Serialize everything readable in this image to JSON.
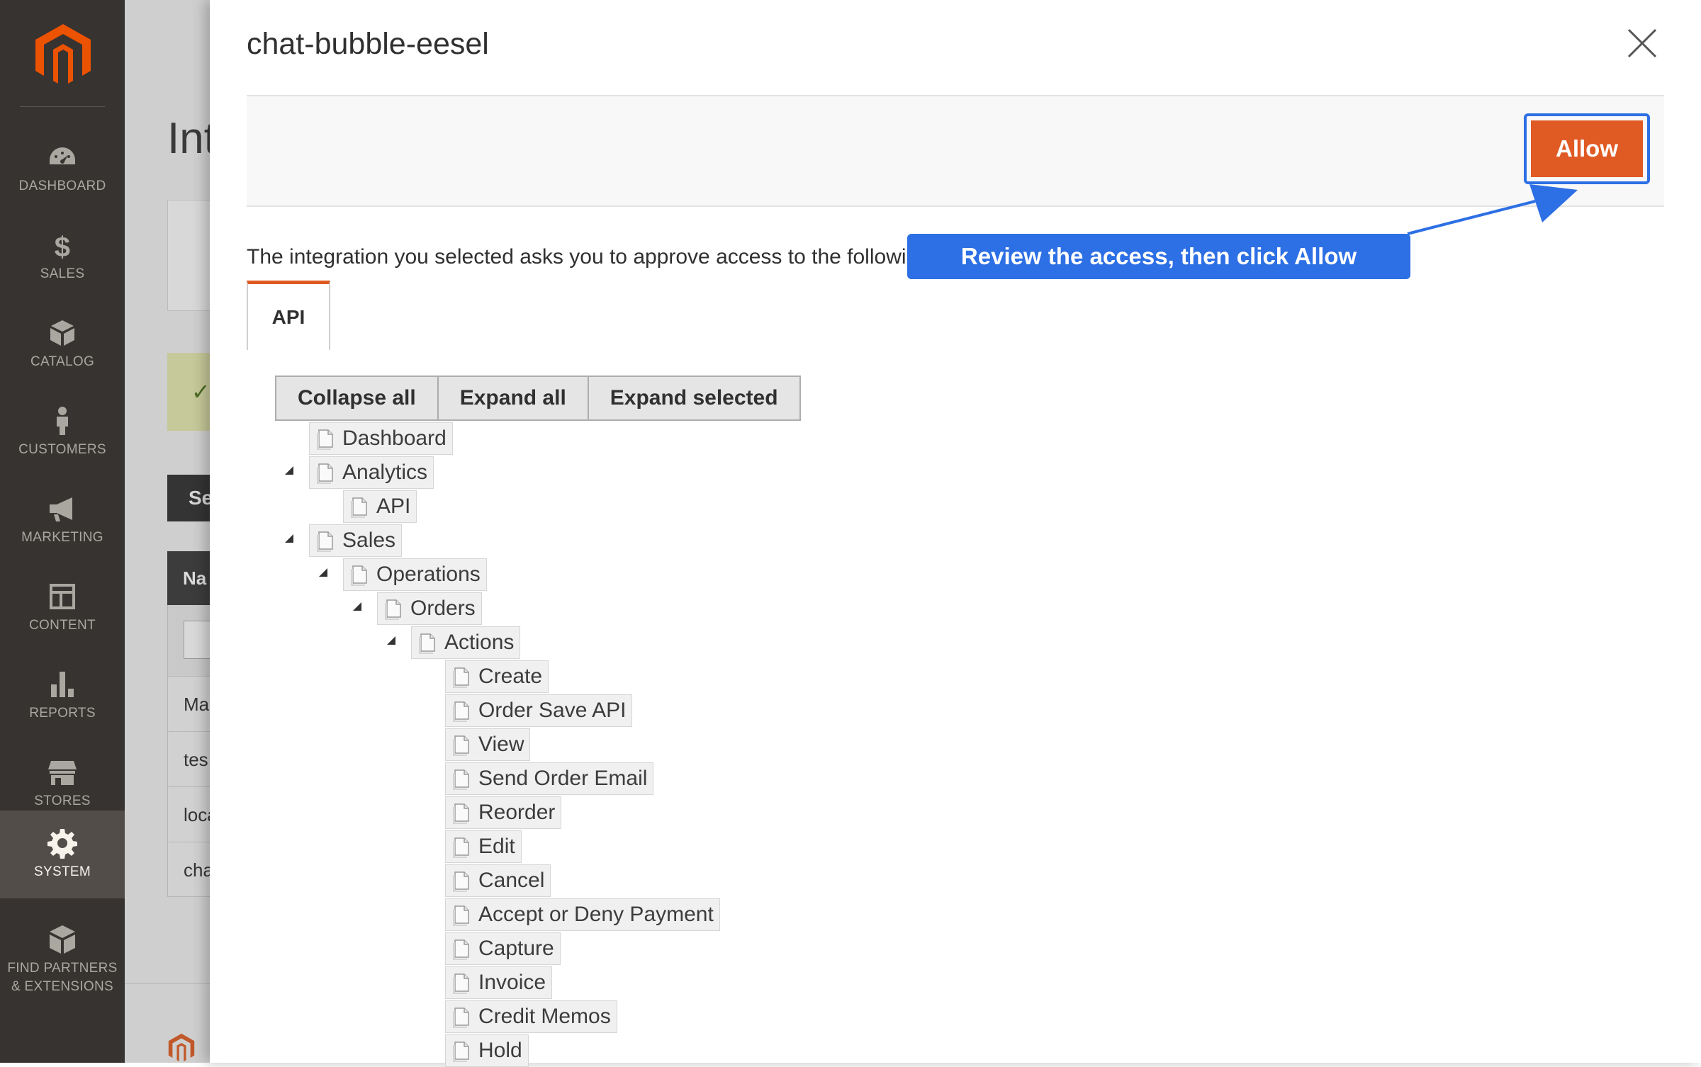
{
  "admin_nav": {
    "items": [
      {
        "label": "DASHBOARD",
        "icon": "dashboard-gauge-icon"
      },
      {
        "label": "SALES",
        "icon": "dollar-icon"
      },
      {
        "label": "CATALOG",
        "icon": "box-icon"
      },
      {
        "label": "CUSTOMERS",
        "icon": "person-icon"
      },
      {
        "label": "MARKETING",
        "icon": "megaphone-icon"
      },
      {
        "label": "CONTENT",
        "icon": "layout-icon"
      },
      {
        "label": "REPORTS",
        "icon": "bar-chart-icon"
      },
      {
        "label": "STORES",
        "icon": "storefront-icon"
      },
      {
        "label": "SYSTEM",
        "icon": "gear-icon",
        "active": true
      },
      {
        "label": "FIND PARTNERS",
        "label2": "& EXTENSIONS",
        "icon": "blocks-icon"
      }
    ]
  },
  "background_page": {
    "title": "Int",
    "button": "Se",
    "table_header": "Na",
    "rows": [
      "Ma",
      "tes",
      "loca",
      "cha"
    ]
  },
  "modal": {
    "title": "chat-bubble-eesel",
    "allow_label": "Allow",
    "intro": "The integration you selected asks you to approve access to the following:",
    "callout": "Review the access, then click Allow",
    "tab_label": "API",
    "tree_buttons": [
      "Collapse all",
      "Expand all",
      "Expand selected"
    ],
    "tree": [
      {
        "label": "Dashboard",
        "level": 0,
        "toggle": false
      },
      {
        "label": "Analytics",
        "level": 0,
        "toggle": true
      },
      {
        "label": "API",
        "level": 1,
        "toggle": false
      },
      {
        "label": "Sales",
        "level": 0,
        "toggle": true
      },
      {
        "label": "Operations",
        "level": 1,
        "toggle": true
      },
      {
        "label": "Orders",
        "level": 2,
        "toggle": true
      },
      {
        "label": "Actions",
        "level": 3,
        "toggle": true
      },
      {
        "label": "Create",
        "level": 4,
        "toggle": false
      },
      {
        "label": "Order Save API",
        "level": 4,
        "toggle": false
      },
      {
        "label": "View",
        "level": 4,
        "toggle": false
      },
      {
        "label": "Send Order Email",
        "level": 4,
        "toggle": false
      },
      {
        "label": "Reorder",
        "level": 4,
        "toggle": false
      },
      {
        "label": "Edit",
        "level": 4,
        "toggle": false
      },
      {
        "label": "Cancel",
        "level": 4,
        "toggle": false
      },
      {
        "label": "Accept or Deny Payment",
        "level": 4,
        "toggle": false
      },
      {
        "label": "Capture",
        "level": 4,
        "toggle": false
      },
      {
        "label": "Invoice",
        "level": 4,
        "toggle": false
      },
      {
        "label": "Credit Memos",
        "level": 4,
        "toggle": false
      },
      {
        "label": "Hold",
        "level": 4,
        "toggle": false
      }
    ]
  },
  "colors": {
    "nav_bg": "#373330",
    "brand_orange": "#e05a23",
    "callout_blue": "#2d6fe4"
  }
}
